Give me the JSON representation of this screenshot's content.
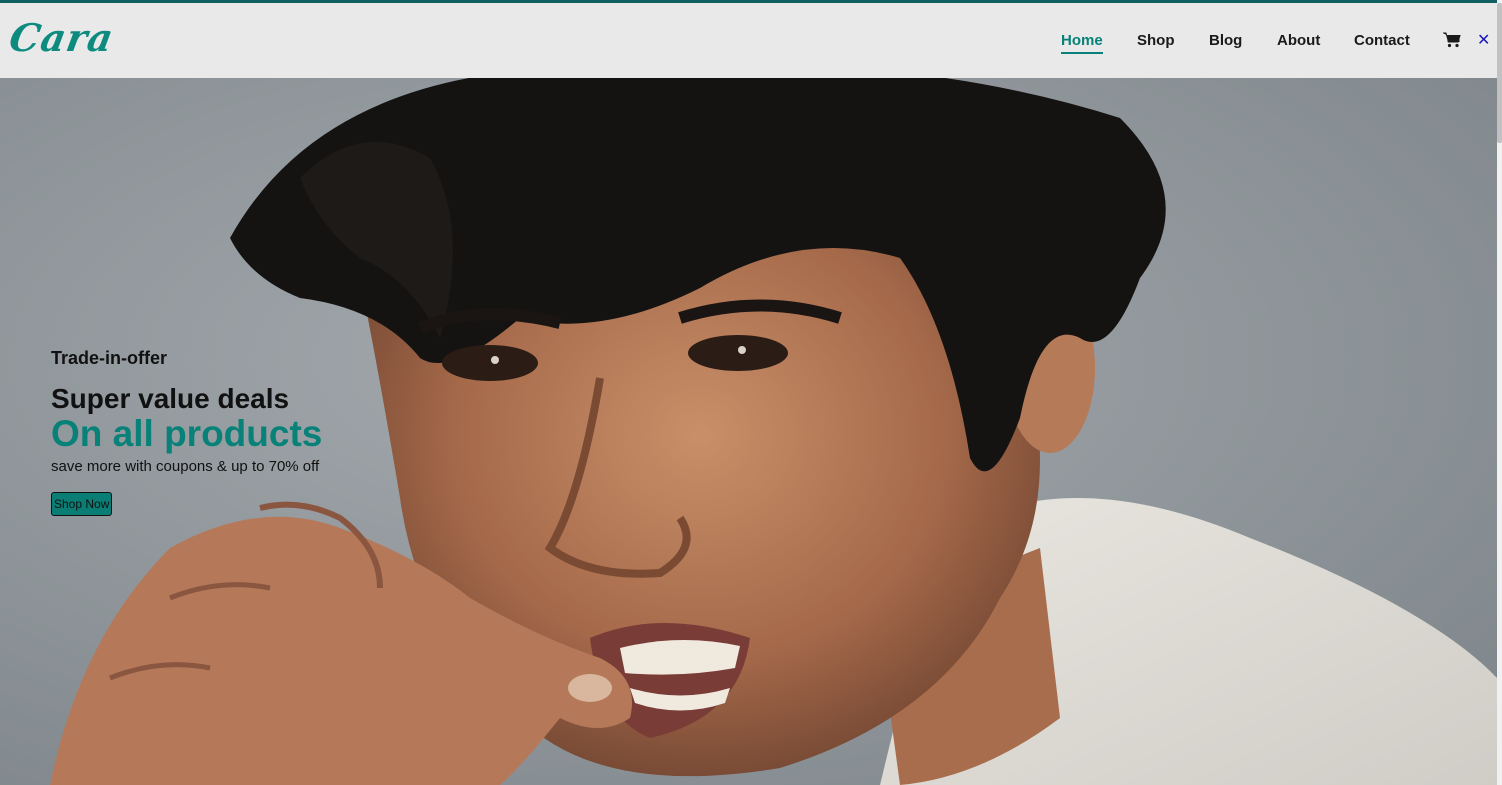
{
  "brand": {
    "logo_text": "Cara",
    "accent_color": "#088178"
  },
  "nav": {
    "items": [
      {
        "label": "Home",
        "active": true
      },
      {
        "label": "Shop",
        "active": false
      },
      {
        "label": "Blog",
        "active": false
      },
      {
        "label": "About",
        "active": false
      },
      {
        "label": "Contact",
        "active": false
      }
    ],
    "cart_icon": "shopping-cart-icon",
    "close_icon": "close-icon"
  },
  "hero": {
    "eyebrow": "Trade-in-offer",
    "headline": "Super value deals",
    "highlight": "On all products",
    "subtext": "save more with coupons & up to 70% off",
    "button_label": "Shop Now",
    "image_icon": "hero-model-photo"
  }
}
